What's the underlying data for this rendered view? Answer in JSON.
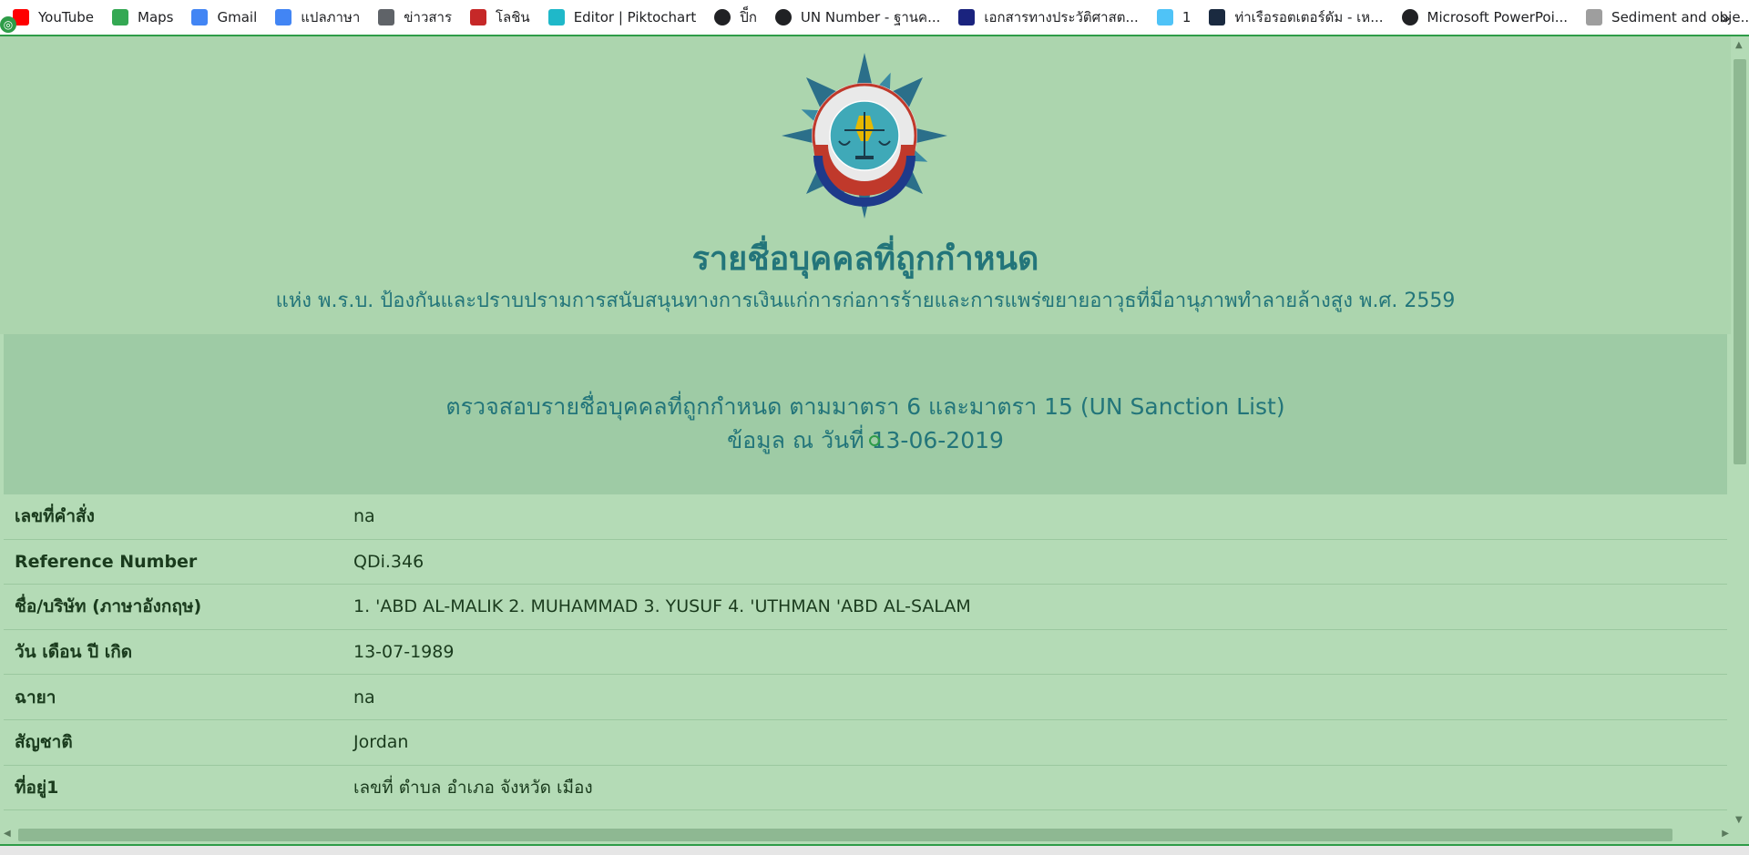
{
  "bookmarks": [
    {
      "label": "YouTube",
      "icon": "youtube-icon",
      "color": "#ff0000"
    },
    {
      "label": "Maps",
      "icon": "maps-icon",
      "color": "#34a853"
    },
    {
      "label": "Gmail",
      "icon": "gmail-icon",
      "color": "#4285f4"
    },
    {
      "label": "แปลภาษา",
      "icon": "translate-icon",
      "color": "#4285f4"
    },
    {
      "label": "ข่าวสาร",
      "icon": "news-icon",
      "color": "#5f6368"
    },
    {
      "label": "โลชิน",
      "icon": "loshin-icon",
      "color": "#c62828"
    },
    {
      "label": "Editor | Piktochart",
      "icon": "piktochart-icon",
      "color": "#1fb8c9"
    },
    {
      "label": "ปิ็ก",
      "icon": "globe-icon",
      "color": "#202124"
    },
    {
      "label": "UN Number - ฐานค...",
      "icon": "globe-icon",
      "color": "#202124"
    },
    {
      "label": "เอกสารทางประวัติศาสต...",
      "icon": "docs-icon",
      "color": "#1a237e"
    },
    {
      "label": "1",
      "icon": "bulb-icon",
      "color": "#4fc3f7"
    },
    {
      "label": "ท่าเรือรอตเตอร์ดัม - เห...",
      "icon": "st-icon",
      "color": "#1a2a40"
    },
    {
      "label": "Microsoft PowerPoi...",
      "icon": "globe-icon",
      "color": "#202124"
    },
    {
      "label": "Sediment and obje...",
      "icon": "sediment-icon",
      "color": "#9e9e9e"
    }
  ],
  "overflow_label": "»",
  "header": {
    "title": "รายชื่อบุคคลที่ถูกกำหนด",
    "subtitle": "แห่ง พ.ร.บ. ป้องกันและปราบปรามการสนับสนุนทางการเงินแก่การก่อการร้ายและการแพร่ขยายอาวุธที่มีอานุภาพทำลายล้างสูง พ.ศ. 2559"
  },
  "info": {
    "line1": "ตรวจสอบรายชื่อบุคคลที่ถูกกำหนด ตามมาตรา 6 และมาตรา 15 (UN Sanction List)",
    "line2": "ข้อมูล ณ วันที่ 13-06-2019"
  },
  "rows": [
    {
      "label": "เลขที่คำสั่ง",
      "value": "na"
    },
    {
      "label": "Reference Number",
      "value": "QDi.346"
    },
    {
      "label": "ชื่อ/บริษัท (ภาษาอังกฤษ)",
      "value": "1. 'ABD AL-MALIK 2. MUHAMMAD 3. YUSUF 4. 'UTHMAN 'ABD AL-SALAM"
    },
    {
      "label": "วัน เดือน ปี เกิด",
      "value": "13-07-1989"
    },
    {
      "label": "ฉายา",
      "value": "na"
    },
    {
      "label": "สัญชาติ",
      "value": "Jordan"
    },
    {
      "label": "ที่อยู่1",
      "value": "เลขที่ ตำบล อำเภอ จังหวัด เมือง"
    }
  ],
  "colors": {
    "page_bg": "#b4dbb6",
    "header_bg": "#acd5ae",
    "info_bg": "#9ecba5",
    "title_color": "#23757a",
    "accent": "#2e9c48"
  }
}
